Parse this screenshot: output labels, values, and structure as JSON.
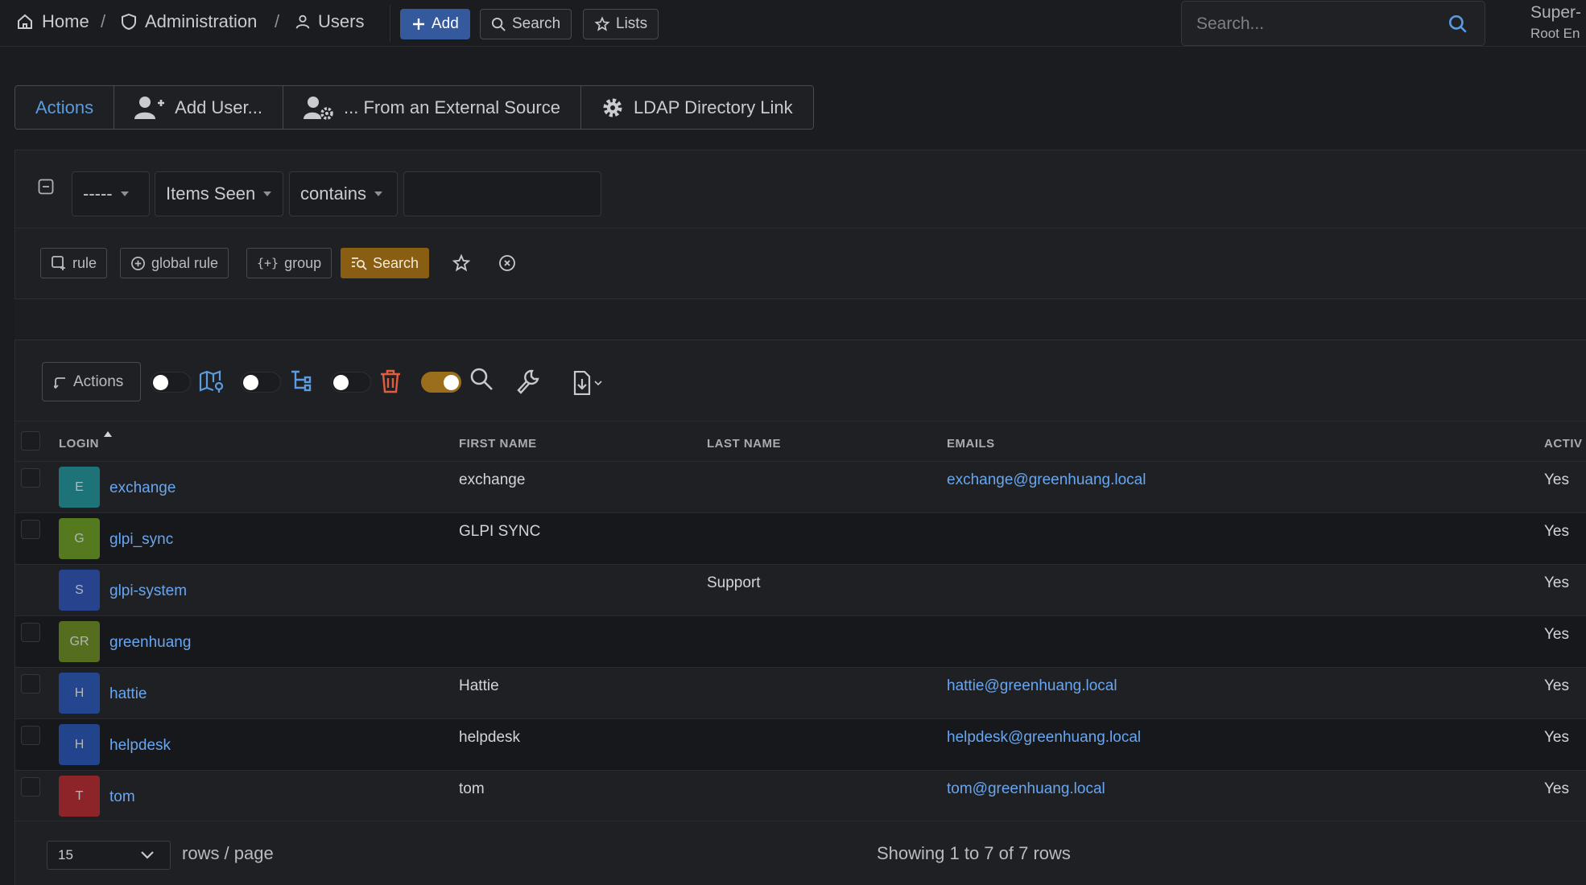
{
  "breadcrumb": {
    "home": "Home",
    "administration": "Administration",
    "users": "Users",
    "separator": "/"
  },
  "toolbar": {
    "add": "Add",
    "search": "Search",
    "lists": "Lists"
  },
  "global_search": {
    "placeholder": "Search..."
  },
  "user_menu": {
    "profile": "Super-",
    "entity": "Root En"
  },
  "action_tabs": [
    {
      "label": "Actions",
      "icon": "none"
    },
    {
      "label": "Add User...",
      "icon": "user-plus-icon"
    },
    {
      "label": "... From an External Source",
      "icon": "users-gear-icon"
    },
    {
      "label": "LDAP Directory Link",
      "icon": "gear-icon"
    }
  ],
  "criteria": {
    "link_operator": "-----",
    "field": "Items Seen",
    "operator": "contains",
    "value": "",
    "buttons": {
      "rule": "rule",
      "global_rule": "global rule",
      "group": "group",
      "search": "Search"
    }
  },
  "list_toolbar": {
    "actions": "Actions",
    "toggles": {
      "map": false,
      "tree": false,
      "trash": false,
      "search": true
    }
  },
  "table": {
    "columns": {
      "login": "LOGIN",
      "first_name": "FIRST NAME",
      "last_name": "LAST NAME",
      "emails": "EMAILS",
      "active": "ACTIV"
    },
    "sort": {
      "column": "login",
      "direction": "ascending"
    },
    "rows": [
      {
        "initials": "E",
        "avatar_color": "#1f8f96",
        "login": "exchange",
        "first_name": "exchange",
        "last_name": "",
        "email": "exchange@greenhuang.local",
        "active": "Yes",
        "checkbox": true
      },
      {
        "initials": "G",
        "avatar_color": "#6a9a1f",
        "login": "glpi_sync",
        "first_name": "GLPI SYNC",
        "last_name": "",
        "email": "",
        "active": "Yes",
        "checkbox": true
      },
      {
        "initials": "S",
        "avatar_color": "#2b4fb1",
        "login": "glpi-system",
        "first_name": "",
        "last_name": "Support",
        "email": "",
        "active": "Yes",
        "checkbox": false
      },
      {
        "initials": "GR",
        "avatar_color": "#6a8a1f",
        "login": "greenhuang",
        "first_name": "",
        "last_name": "",
        "email": "",
        "active": "Yes",
        "checkbox": true
      },
      {
        "initials": "H",
        "avatar_color": "#2553b3",
        "login": "hattie",
        "first_name": "Hattie",
        "last_name": "",
        "email": "hattie@greenhuang.local",
        "active": "Yes",
        "checkbox": true
      },
      {
        "initials": "H",
        "avatar_color": "#2553b3",
        "login": "helpdesk",
        "first_name": "helpdesk",
        "last_name": "",
        "email": "helpdesk@greenhuang.local",
        "active": "Yes",
        "checkbox": true
      },
      {
        "initials": "T",
        "avatar_color": "#b3262d",
        "login": "tom",
        "first_name": "tom",
        "last_name": "",
        "email": "tom@greenhuang.local",
        "active": "Yes",
        "checkbox": true
      }
    ]
  },
  "pager": {
    "page_size": "15",
    "rows_label": "rows / page",
    "summary": "Showing 1 to 7 of 7 rows"
  },
  "colors": {
    "background": "#1b1c20",
    "panel": "#1e2024",
    "primary": "#35599d",
    "link": "#6aa6ee",
    "warning": "#8a5e12",
    "danger": "#e05d3f"
  }
}
